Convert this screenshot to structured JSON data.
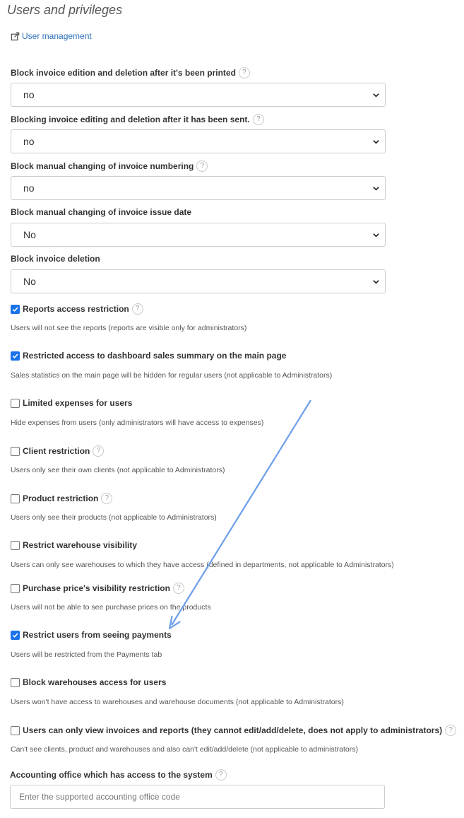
{
  "page_title": "Users and privileges",
  "user_management_link": "User management",
  "help_glyph": "?",
  "selects": [
    {
      "label": "Block invoice edition and deletion after it's been printed",
      "value": "no"
    },
    {
      "label": "Blocking invoice editing and deletion after it has been sent.",
      "value": "no"
    },
    {
      "label": "Block manual changing of invoice numbering",
      "value": "no"
    },
    {
      "label": "Block manual changing of invoice issue date",
      "value": "No"
    },
    {
      "label": "Block invoice deletion",
      "value": "No"
    }
  ],
  "checkboxes": [
    {
      "label": "Reports access restriction",
      "checked": true,
      "description": "Users will not see the reports (reports are visible only for administrators)"
    },
    {
      "label": "Restricted access to dashboard sales summary on the main page",
      "checked": true,
      "description": "Sales statistics on the main page will be hidden for regular users (not applicable to Administrators)"
    },
    {
      "label": "Limited expenses for users",
      "checked": false,
      "description": "Hide expenses from users (only administrators will have access to expenses)"
    },
    {
      "label": "Client restriction",
      "checked": false,
      "description": "Users only see their own clients (not applicable to Administrators)"
    },
    {
      "label": "Product restriction",
      "checked": false,
      "description": "Users only see their products (not applicable to Administrators)"
    },
    {
      "label": "Restrict warehouse visibility",
      "checked": false,
      "description": "Users can only see warehouses to which they have access (defined in departments, not applicable to Administrators)"
    },
    {
      "label": "Purchase price's visibility restriction",
      "checked": false,
      "description": "Users will not be able to see purchase prices on the products"
    },
    {
      "label": "Restrict users from seeing payments",
      "checked": true,
      "description": "Users will be restricted from the Payments tab"
    },
    {
      "label": "Block warehouses access for users",
      "checked": false,
      "description": "Users won't have access to warehouses and warehouse documents (not applicable to Administrators)"
    },
    {
      "label": "Users can only view invoices and reports (they cannot edit/add/delete, does not apply to administrators)",
      "checked": false,
      "description": "Can't see clients, product and warehouses and also can't edit/add/delete (not applicable to administrators)"
    }
  ],
  "accounting_office": {
    "label": "Accounting office which has access to the system",
    "placeholder": "Enter the supported accounting office code"
  },
  "annotation_arrow_color": "#6d9eeb",
  "accent_color": "#1a73e8",
  "link_color": "#2a6ebb"
}
